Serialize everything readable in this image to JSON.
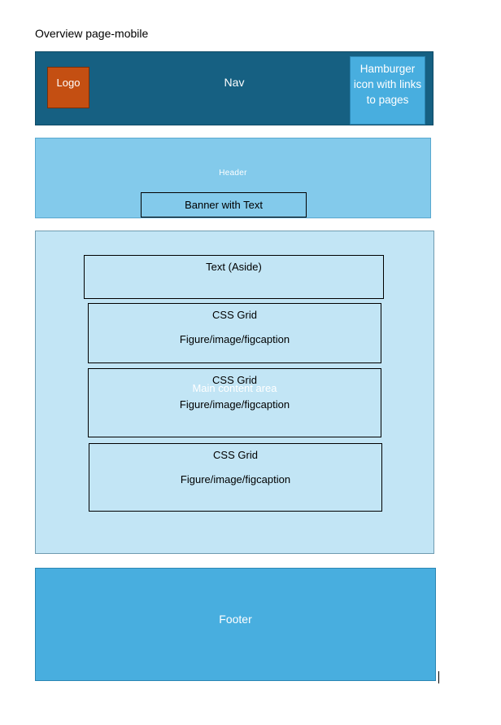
{
  "page_title": "Overview page-mobile",
  "nav": {
    "label": "Nav",
    "logo": "Logo",
    "hamburger": "Hamburger icon with links to pages"
  },
  "header": {
    "label": "Header",
    "banner": "Banner with Text"
  },
  "main": {
    "label": "Main content area",
    "aside": "Text (Aside)",
    "grids": [
      {
        "title": "CSS Grid",
        "caption": "Figure/image/figcaption"
      },
      {
        "title": "CSS Grid",
        "caption": "Figure/image/figcaption"
      },
      {
        "title": "CSS Grid",
        "caption": "Figure/image/figcaption"
      }
    ]
  },
  "footer": {
    "label": "Footer"
  },
  "colors": {
    "nav_bg": "#166082",
    "logo_bg": "#c44f12",
    "hamburger_bg": "#48aedf",
    "header_bg": "#83caeb",
    "main_bg": "#c2e5f5",
    "footer_bg": "#48aedf"
  }
}
